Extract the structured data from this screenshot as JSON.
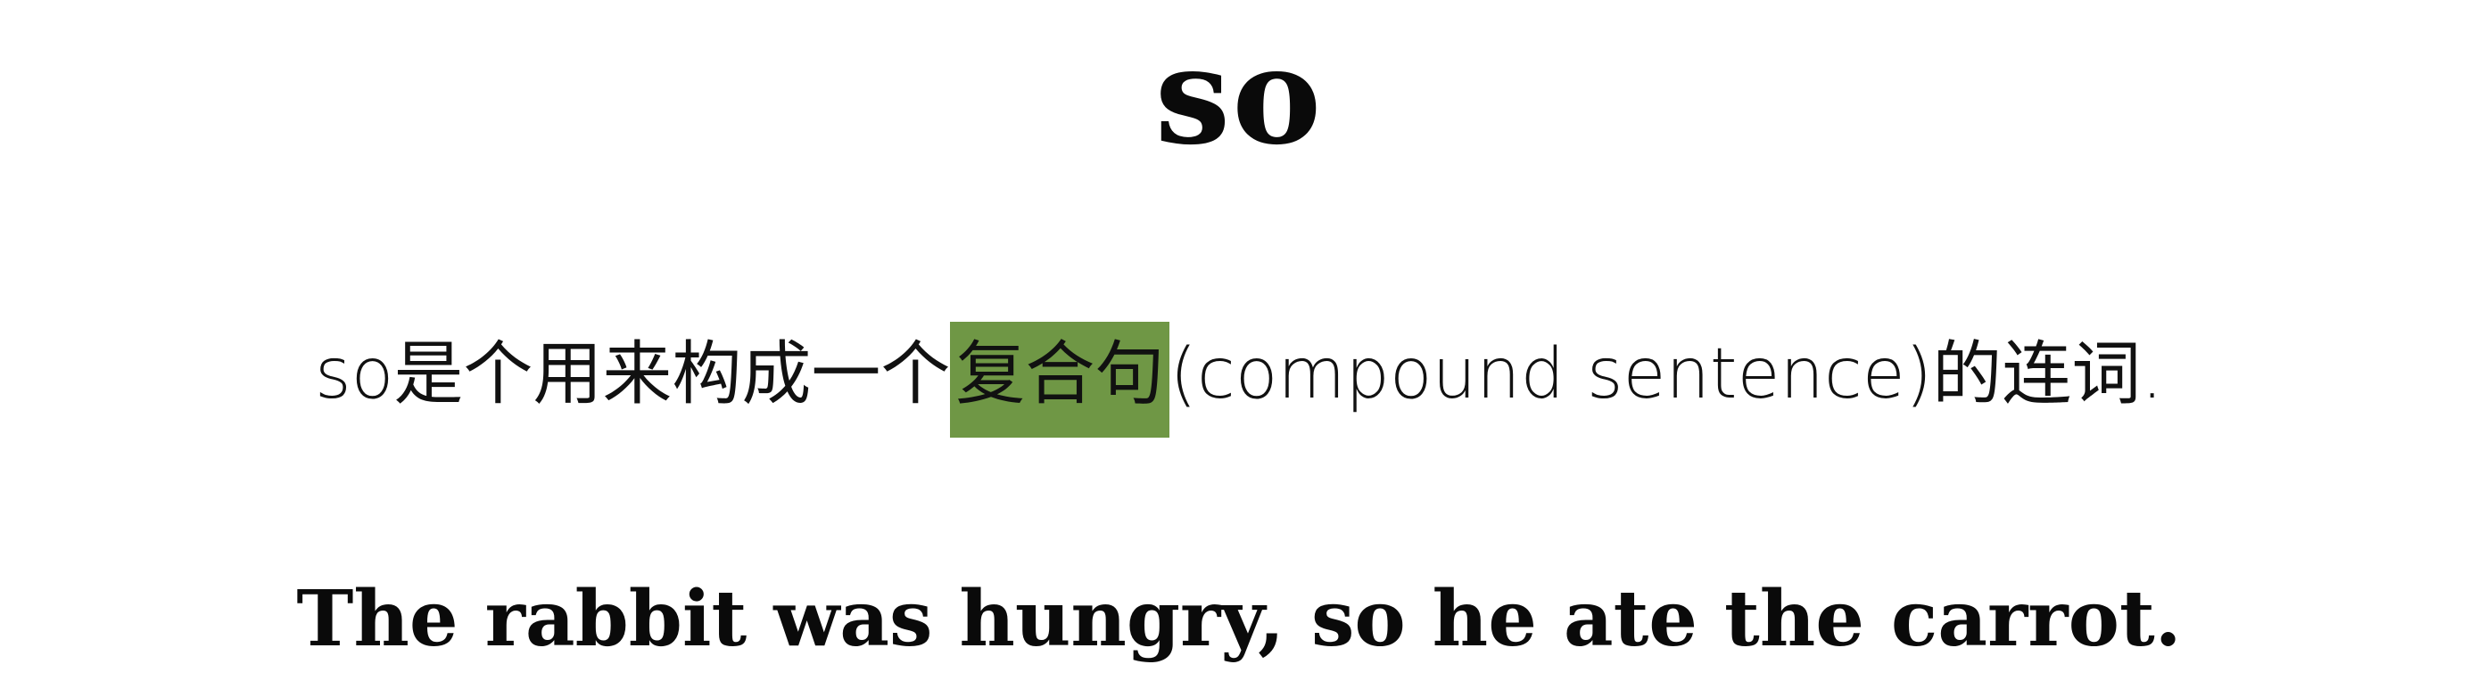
{
  "title": "so",
  "definition": {
    "before": "so是个用来构成一个",
    "highlight": "复合句",
    "after": "(compound sentence)的连词."
  },
  "example": "The rabbit was hungry, so he ate the carrot.",
  "colors": {
    "highlight": "#6f9745",
    "text": "#0a0a0a",
    "background": "#ffffff"
  }
}
